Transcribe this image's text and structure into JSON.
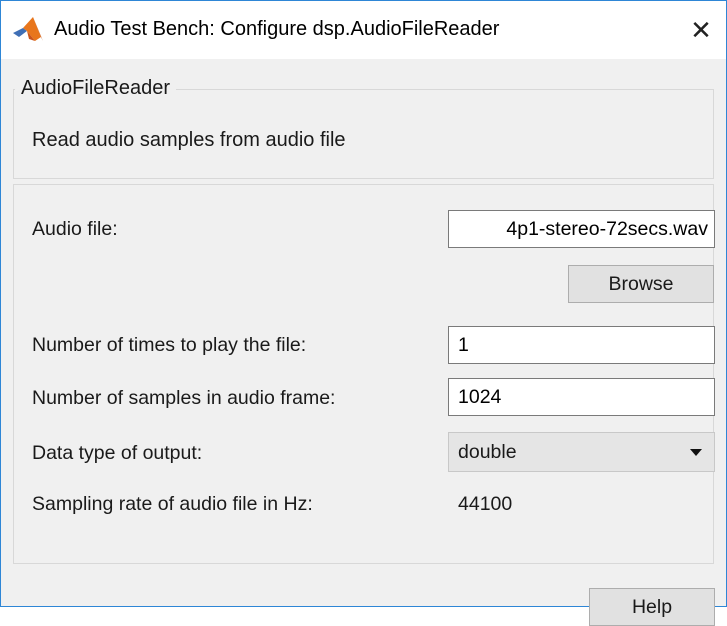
{
  "window": {
    "title": "Audio Test Bench: Configure dsp.AudioFileReader",
    "close_glyph": "✕",
    "icon": "matlab-logo-icon"
  },
  "description_panel": {
    "legend": "AudioFileReader",
    "text": "Read audio samples from audio file"
  },
  "parameters": {
    "audio_file": {
      "label": "Audio file:",
      "value": "4p1-stereo-72secs.wav"
    },
    "browse_label": "Browse",
    "play_count": {
      "label": "Number of times to play the file:",
      "value": "1"
    },
    "frame_size": {
      "label": "Number of samples in audio frame:",
      "value": "1024"
    },
    "output_type": {
      "label": "Data type of output:",
      "selected": "double"
    },
    "sample_rate": {
      "label": "Sampling rate of audio file in Hz:",
      "value": "44100"
    }
  },
  "footer": {
    "help_label": "Help"
  },
  "colors": {
    "window_border": "#2e86d6",
    "background": "#f0f0f0",
    "button": "#e1e1e1"
  }
}
